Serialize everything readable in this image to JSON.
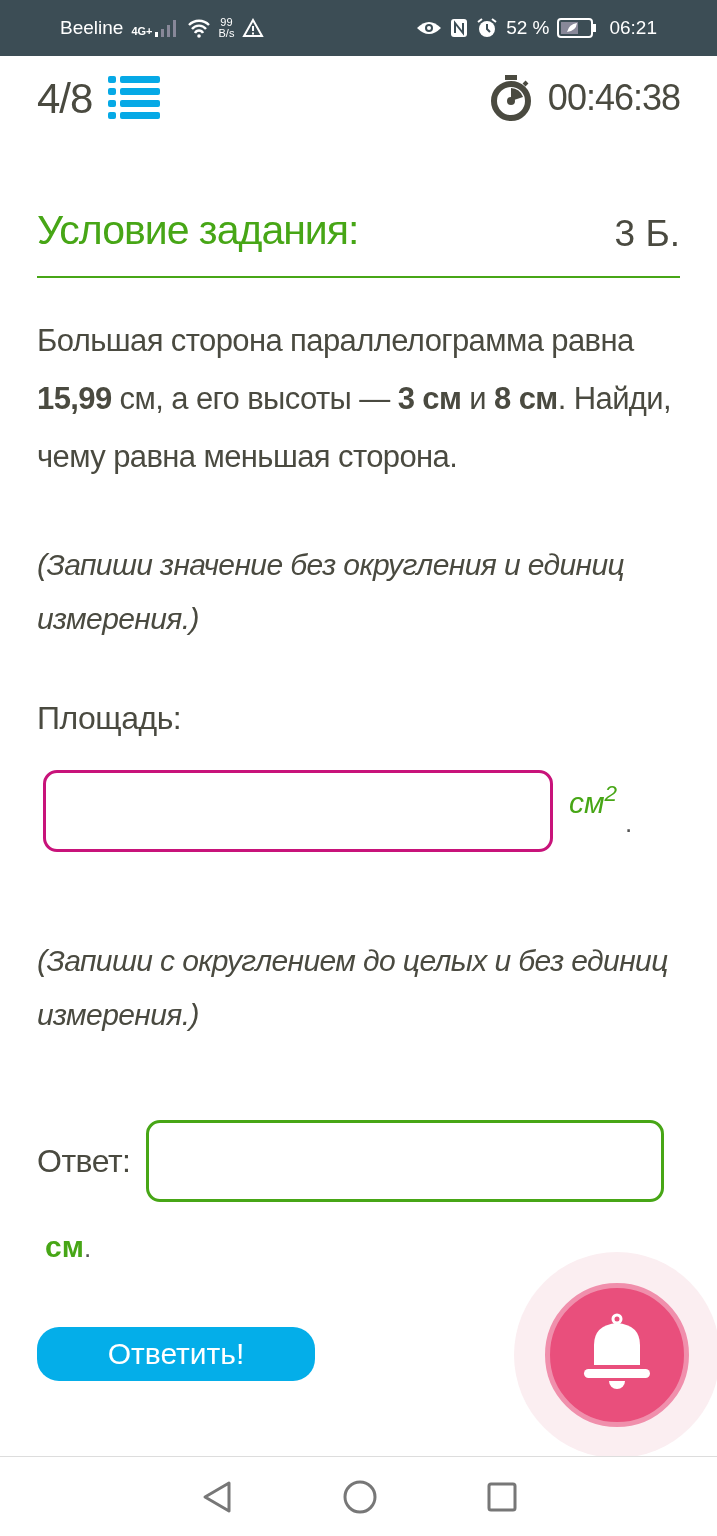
{
  "status_bar": {
    "carrier": "Beeline",
    "network": "4G+",
    "speed_value": "99",
    "speed_unit": "B/s",
    "battery": "52 %",
    "time": "06:21"
  },
  "header": {
    "progress": "4/8",
    "timer": "00:46:38"
  },
  "task": {
    "title": "Условие задания:",
    "points": "3 Б.",
    "question": "Большая сторона параллелограмма равна **15,99** см, а его высоты — **3 см** и **8 см**. Найди, чему равна меньшая сторона.",
    "fields": [
      {
        "kind": "stacked",
        "hint": "(Запиши значение без округления и единиц измерения.)",
        "label": "Площадь:",
        "unit": "см$^{2}$",
        "trailing": ".",
        "color": "#c8137a"
      },
      {
        "kind": "inline",
        "hint": "(Запиши с округлением до целых и без единиц измерения.)",
        "label": "Ответ:",
        "unit": "см",
        "trailing": ".",
        "color": "#47a616"
      }
    ],
    "submit": "Ответить!"
  }
}
